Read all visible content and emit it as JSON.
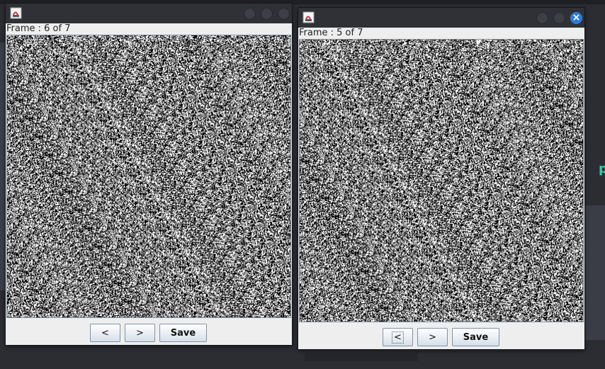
{
  "windows": [
    {
      "id": "left",
      "frame_label": "Frame : 6 of 7",
      "buttons": {
        "prev": "<",
        "next": ">",
        "save": "Save"
      }
    },
    {
      "id": "right",
      "frame_label": "Frame : 5 of 7",
      "buttons": {
        "prev": "<",
        "next": ">",
        "save": "Save"
      },
      "close_glyph": "×"
    }
  ],
  "icons": {
    "app": "java-app-icon",
    "close": "close-icon",
    "minimize": "minimize-icon",
    "maximize": "maximize-icon"
  },
  "colors": {
    "titlebar": "#2f3137",
    "window_body": "#eeeeee",
    "close_accent": "#2e7bd6",
    "desktop": "#2b2d33"
  },
  "background": {
    "partial_glyph": "p"
  }
}
